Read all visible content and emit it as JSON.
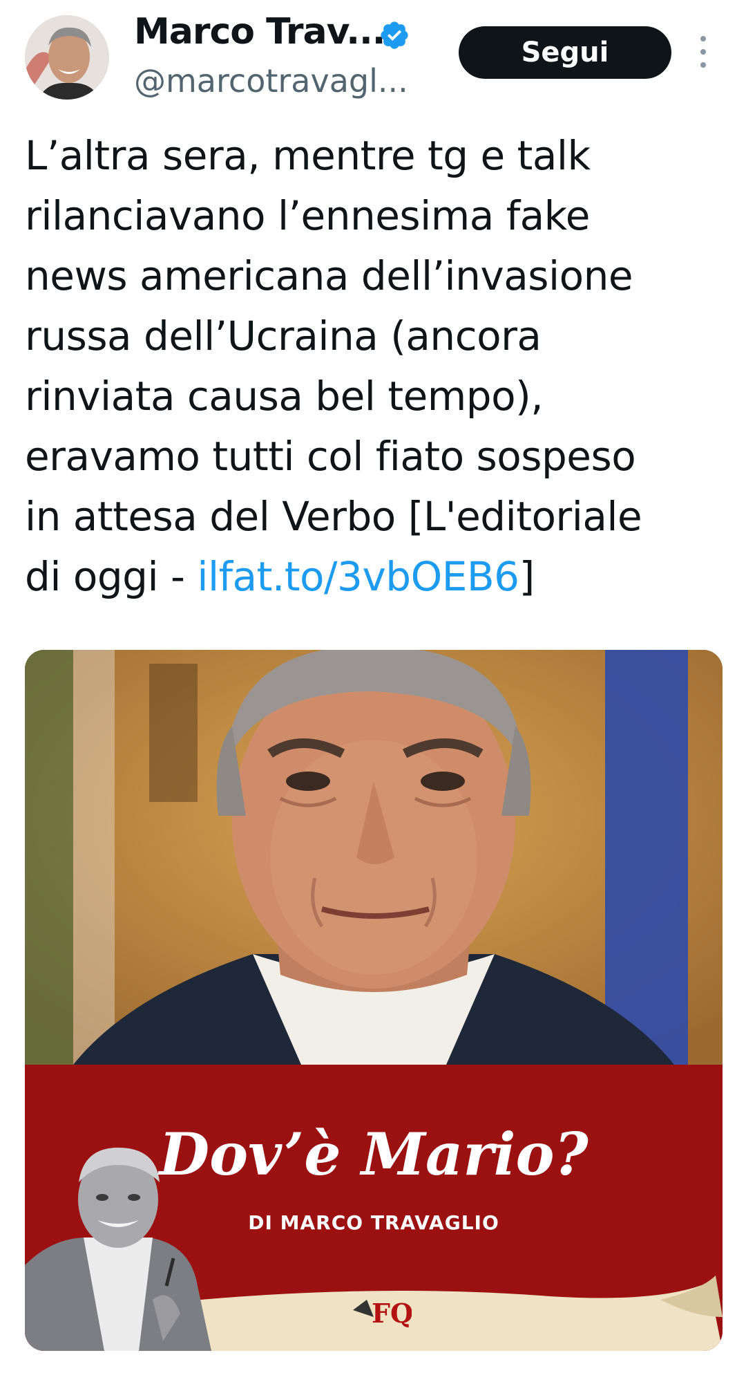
{
  "header": {
    "display_name": "Marco Trav...",
    "handle": "@marcotravagl...",
    "follow_label": "Segui"
  },
  "tweet": {
    "lines": [
      "L’altra sera, mentre tg e talk",
      "rilanciavano l’ennesima fake",
      "news americana dell’invasione",
      "russa dell’Ucraina (ancora",
      "rinviata causa bel tempo),",
      "eravamo tutti col fiato sospeso",
      "in attesa del Verbo [L'editoriale"
    ],
    "last_line_prefix": "di oggi - ",
    "link_text": "ilfat.to/3vbOEB6",
    "last_line_suffix": "]"
  },
  "media": {
    "title": "Dov’è Mario?",
    "byline": "DI MARCO TRAVAGLIO",
    "logo_text": "FQ"
  },
  "colors": {
    "link": "#1d9bf0",
    "follow_bg": "#0f1419",
    "banner": "#9b1010",
    "verified": "#1d9bf0"
  },
  "icons": [
    "verified-badge-icon",
    "more-options-icon",
    "avatar",
    "fq-logo"
  ]
}
